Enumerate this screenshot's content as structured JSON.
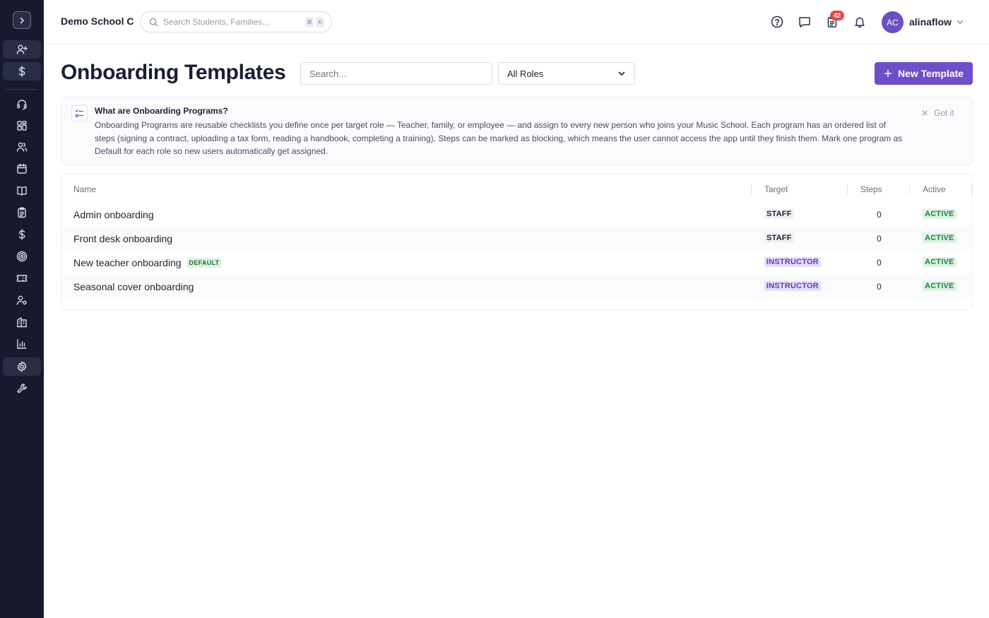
{
  "sidebar": {
    "toggle_icon": "chevron-right-icon",
    "items": [
      {
        "icon": "user-plus-icon",
        "highlight": true
      },
      {
        "icon": "dollar-icon",
        "highlight": true
      },
      {
        "icon": "headset-icon",
        "highlight": false
      },
      {
        "icon": "grid-icon",
        "highlight": false
      },
      {
        "icon": "users-icon",
        "highlight": false
      },
      {
        "icon": "calendar-icon",
        "highlight": false
      },
      {
        "icon": "book-icon",
        "highlight": false
      },
      {
        "icon": "clipboard-icon",
        "highlight": false
      },
      {
        "icon": "dollar-icon",
        "highlight": false
      },
      {
        "icon": "target-icon",
        "highlight": false
      },
      {
        "icon": "ticket-icon",
        "highlight": false
      },
      {
        "icon": "user-settings-icon",
        "highlight": false
      },
      {
        "icon": "building-icon",
        "highlight": false
      },
      {
        "icon": "bar-chart-icon",
        "highlight": false
      },
      {
        "icon": "settings-icon",
        "highlight": true
      },
      {
        "icon": "wrench-icon",
        "highlight": false
      }
    ]
  },
  "header": {
    "school_name": "Demo School C",
    "search_placeholder": "Search Students, Families...",
    "search_shortcut": [
      "⌘",
      "K"
    ],
    "notification_count": "42",
    "user_initials": "AC",
    "username": "alinaflow"
  },
  "page": {
    "title": "Onboarding Templates",
    "search_placeholder": "Search...",
    "role_filter": "All Roles",
    "new_button": "New Template"
  },
  "info": {
    "title": "What are Onboarding Programs?",
    "body": "Onboarding Programs are reusable checklists you define once per target role — Teacher, family, or employee — and assign to every new person who joins your Music School. Each program has an ordered list of steps (signing a contract, uploading a tax form, reading a handbook, completing a training). Steps can be marked as blocking, which means the user cannot access the app until they finish them. Mark one program as Default for each role so new users automatically get assigned.",
    "dismiss": "Got it"
  },
  "table": {
    "columns": {
      "name": "Name",
      "target": "Target",
      "steps": "Steps",
      "active": "Active"
    },
    "rows": [
      {
        "name": "Admin onboarding",
        "default_label": "",
        "target": "STAFF",
        "steps": "0",
        "status": "ACTIVE"
      },
      {
        "name": "Front desk onboarding",
        "default_label": "",
        "target": "STAFF",
        "steps": "0",
        "status": "ACTIVE"
      },
      {
        "name": "New teacher onboarding",
        "default_label": "DEFAULT",
        "target": "INSTRUCTOR",
        "steps": "0",
        "status": "ACTIVE"
      },
      {
        "name": "Seasonal cover onboarding",
        "default_label": "",
        "target": "INSTRUCTOR",
        "steps": "0",
        "status": "ACTIVE"
      }
    ]
  },
  "colors": {
    "sidebar_bg": "#171a2e",
    "accent": "#6d4fc9",
    "badge": "#e5484d",
    "active_green": "#1e7a3c"
  }
}
